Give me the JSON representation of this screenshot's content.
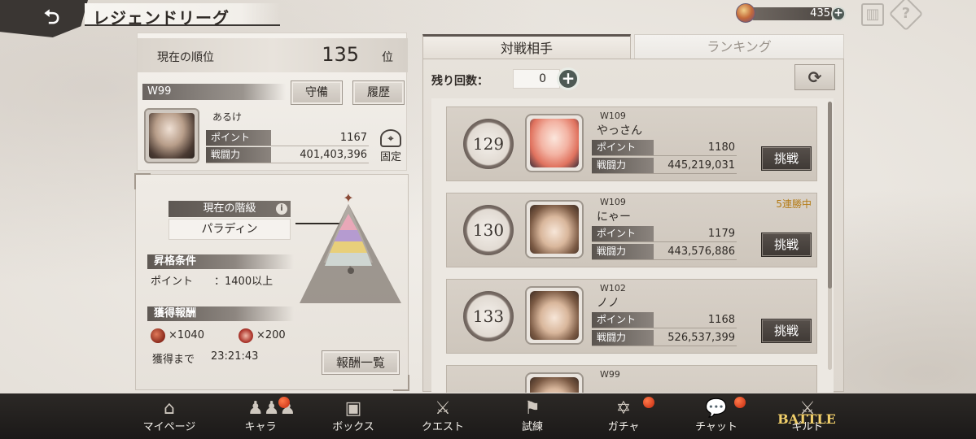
{
  "header": {
    "title": "レジェンドリーグ",
    "currency_value": "435"
  },
  "my_rank": {
    "label": "現在の順位",
    "value": "135",
    "unit": "位"
  },
  "player": {
    "world": "W99",
    "defense_label": "守備",
    "history_label": "履歴",
    "name": "あるけ",
    "point_label": "ポイント",
    "point_value": "1167",
    "power_label": "戦闘力",
    "power_value": "401,403,396",
    "fix_label": "固定"
  },
  "tier": {
    "head": "現在の階級",
    "value": "パラディン",
    "promo_head": "昇格条件",
    "promo_cond_label": "ポイント",
    "promo_cond_value": "：1400以上",
    "reward_head": "獲得報酬",
    "reward1": "×1040",
    "reward2": "×200",
    "until_label": "獲得まで",
    "until_value": "23:21:43",
    "reward_list_button": "報酬一覧"
  },
  "tabs": {
    "opponents": "対戦相手",
    "ranking": "ランキング"
  },
  "remaining": {
    "label": "残り回数：",
    "value": "0"
  },
  "opponents": [
    {
      "rank": "129",
      "world": "W109",
      "name": "やっさん",
      "point_label": "ポイント",
      "point": "1180",
      "power_label": "戦闘力",
      "power": "445,219,031",
      "button": "挑戦",
      "streak": ""
    },
    {
      "rank": "130",
      "world": "W109",
      "name": "にゃー",
      "point_label": "ポイント",
      "point": "1179",
      "power_label": "戦闘力",
      "power": "443,576,886",
      "button": "挑戦",
      "streak": "5連勝中"
    },
    {
      "rank": "133",
      "world": "W102",
      "name": "ノノ",
      "point_label": "ポイント",
      "point": "1168",
      "power_label": "戦闘力",
      "power": "526,537,399",
      "button": "挑戦",
      "streak": ""
    },
    {
      "world": "W99"
    }
  ],
  "nav": {
    "items": [
      "マイページ",
      "キャラ",
      "ボックス",
      "クエスト",
      "試練",
      "ガチャ",
      "チャット",
      "ギルド"
    ],
    "battle_logo": "BATTLE"
  },
  "colors": {
    "accent_dark": "#3a3633",
    "badge_red": "#d6401f",
    "streak_gold": "#b47b16",
    "battle_gold": "#f1cf6a"
  }
}
